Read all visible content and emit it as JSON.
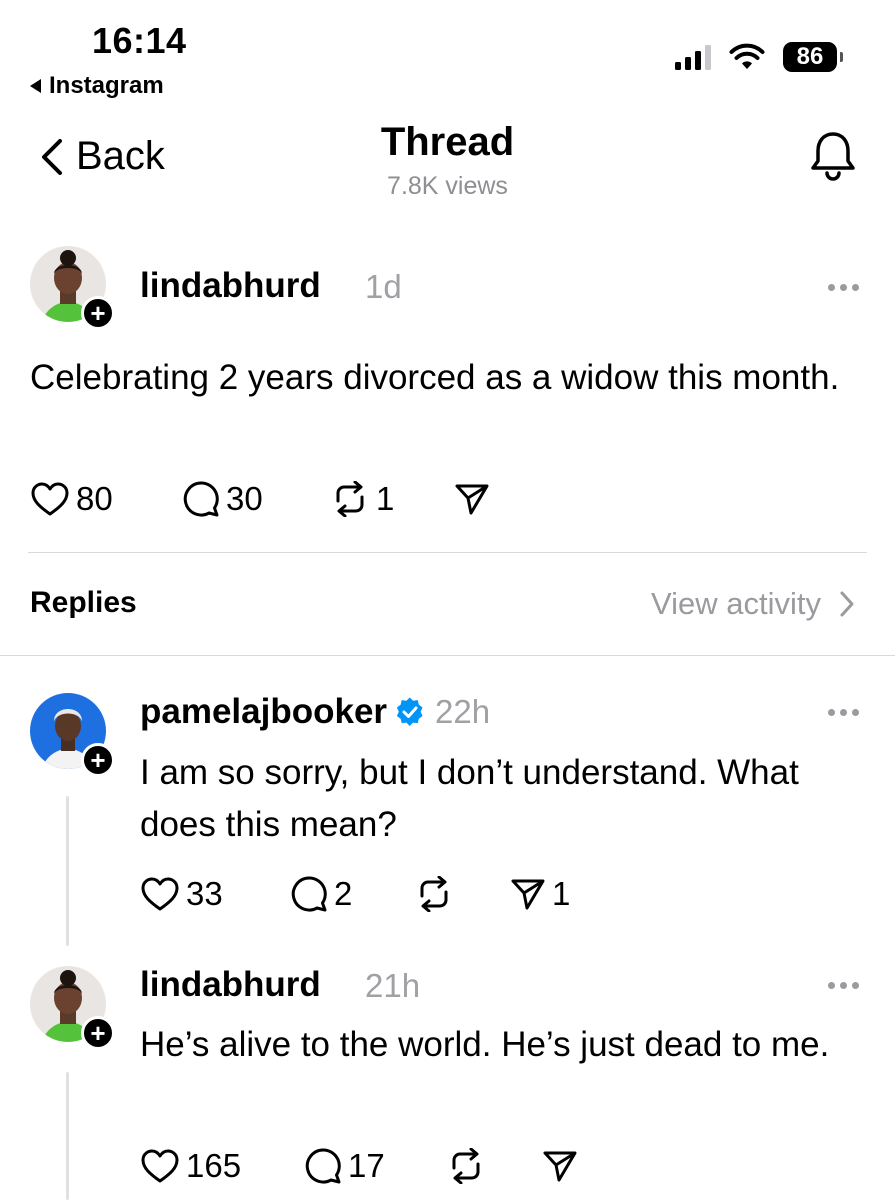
{
  "status_bar": {
    "time": "16:14",
    "back_app": "Instagram",
    "battery": "86"
  },
  "header": {
    "back_label": "Back",
    "title": "Thread",
    "views": "7.8K views"
  },
  "main_post": {
    "username": "lindabhurd",
    "age": "1d",
    "text": "Celebrating 2 years divorced as a widow this month.",
    "likes": "80",
    "comments": "30",
    "reposts": "1"
  },
  "replies_section": {
    "label": "Replies",
    "view_activity": "View activity"
  },
  "replies": [
    {
      "username": "pamelajbooker",
      "verified": true,
      "age": "22h",
      "text": "I am so sorry, but I don’t understand. What does this mean?",
      "likes": "33",
      "comments": "2",
      "reposts": "",
      "shares": "1"
    },
    {
      "username": "lindabhurd",
      "verified": false,
      "age": "21h",
      "text": "He’s alive to the world. He’s just dead to me.",
      "likes": "165",
      "comments": "17",
      "reposts": "",
      "shares": ""
    }
  ],
  "colors": {
    "muted_text": "#8e8e93",
    "verified_blue": "#0095f6",
    "divider": "#d9d9dc"
  }
}
